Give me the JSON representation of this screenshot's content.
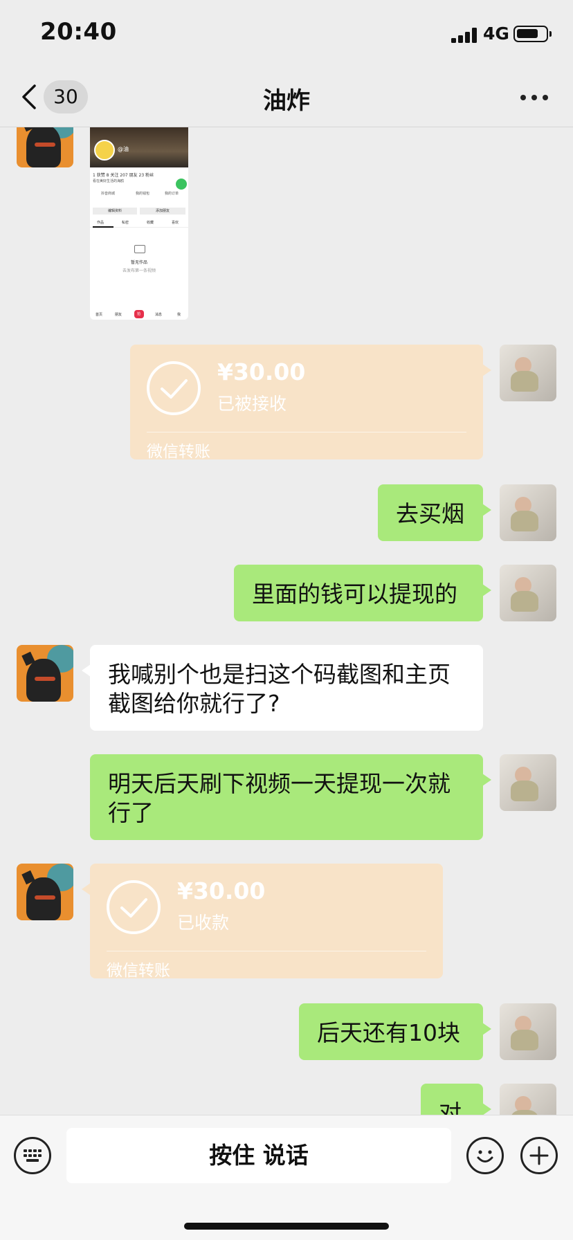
{
  "status_bar": {
    "time": "20:40",
    "network": "4G"
  },
  "nav": {
    "back_badge": "30",
    "title": "油炸"
  },
  "image_message": {
    "profile_name": "@油",
    "stats": "1 获赞   8 关注   207 朋友   23 粉丝",
    "bio": "看在美好生活的海鸥",
    "row1_left": "抖音商城",
    "row1_mid": "我的钱包",
    "row1_right": "我的订单",
    "btn_edit": "编辑资料",
    "btn_add": "添加朋友",
    "tabs": [
      "作品",
      "私密",
      "收藏",
      "喜欢"
    ],
    "empty_title": "暂无作品",
    "empty_sub": "去发布第一条视频",
    "bottom_nav": [
      "首页",
      "朋友",
      "消息",
      "我"
    ],
    "center_btn": "拍"
  },
  "transfer_out": {
    "amount": "¥30.00",
    "status": "已被接收",
    "footer": "微信转账"
  },
  "transfer_in": {
    "amount": "¥30.00",
    "status": "已收款",
    "footer": "微信转账"
  },
  "messages": {
    "m1": "去买烟",
    "m2": "里面的钱可以提现的",
    "m3": "我喊别个也是扫这个码截图和主页截图给你就行了?",
    "m4": "明天后天刷下视频一天提现一次就行了",
    "m5": "后天还有10块",
    "m6": "对"
  },
  "input": {
    "hold_to_talk": "按住 说话"
  },
  "colors": {
    "background": "#ededed",
    "my_bubble": "#a9e97b",
    "their_bubble": "#ffffff",
    "transfer_card": "#f8e3c8"
  }
}
